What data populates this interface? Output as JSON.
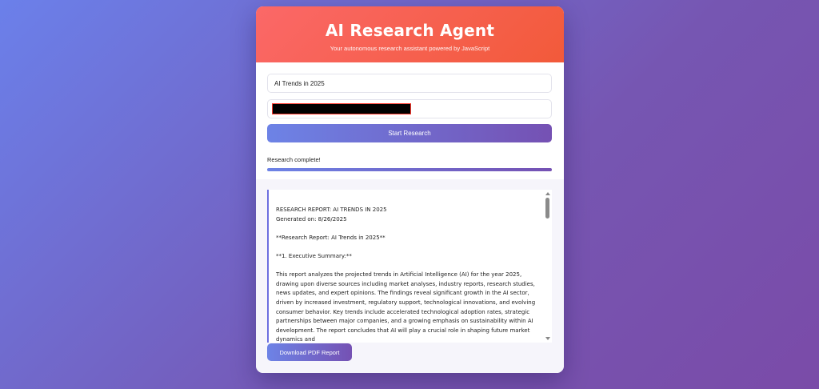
{
  "header": {
    "title": "AI Research Agent",
    "subtitle": "Your autonomous research assistant powered by JavaScript"
  },
  "form": {
    "topic_value": "AI Trends in 2025",
    "start_label": "Start Research"
  },
  "status": {
    "text": "Research complete!",
    "progress_percent": 100
  },
  "report": {
    "paragraphs": [
      "RESEARCH REPORT: AI TRENDS IN 2025\nGenerated on: 8/26/2025",
      "**Research Report: AI Trends in 2025**",
      "**1. Executive Summary:**",
      "This report analyzes the projected trends in Artificial Intelligence (AI) for the year 2025, drawing upon diverse sources including market analyses, industry reports, research studies, news updates, and expert opinions.  The findings reveal significant growth in the AI sector, driven by increased investment, regulatory support, technological innovations, and evolving consumer behavior.  Key trends include accelerated technological adoption rates, strategic partnerships between major companies, and a growing emphasis on sustainability within AI development.  The report concludes that AI will play a crucial role in shaping future market dynamics and"
    ]
  },
  "download": {
    "label": "Download PDF Report"
  },
  "colors": {
    "header_start": "#fb6868",
    "header_end": "#f25a3a",
    "button_start": "#6d83e6",
    "button_end": "#7551b3",
    "report_accent": "#6d6fe0"
  }
}
